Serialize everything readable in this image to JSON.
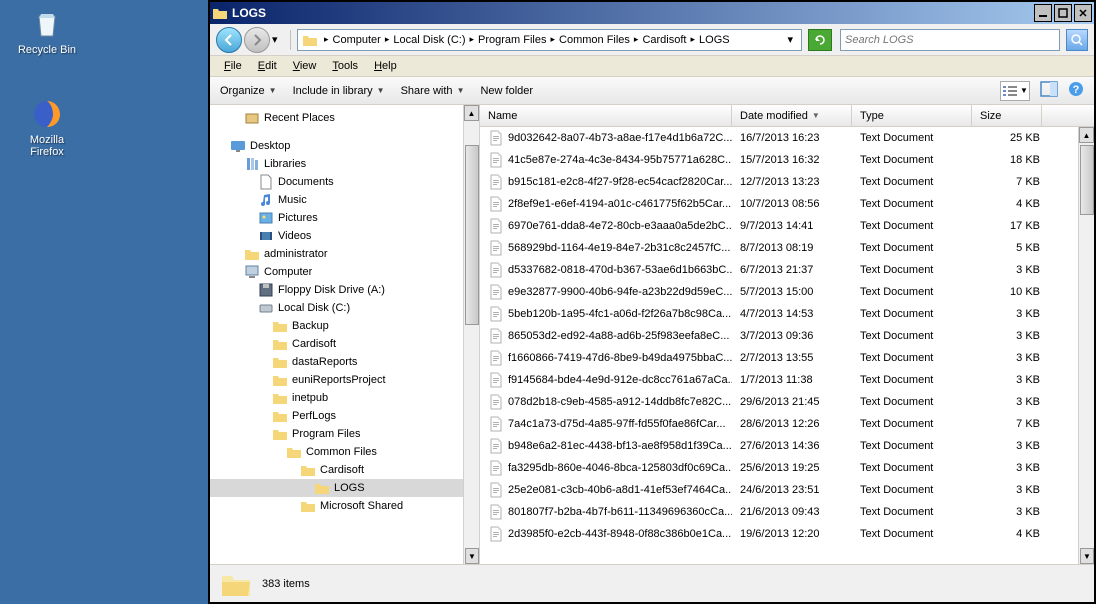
{
  "desktop": {
    "recycle_bin": "Recycle Bin",
    "firefox": "Mozilla Firefox"
  },
  "window": {
    "title": "LOGS"
  },
  "breadcrumb": {
    "items": [
      "Computer",
      "Local Disk (C:)",
      "Program Files",
      "Common Files",
      "Cardisoft",
      "LOGS"
    ]
  },
  "search": {
    "placeholder": "Search LOGS"
  },
  "menubar": {
    "file": "File",
    "edit": "Edit",
    "view": "View",
    "tools": "Tools",
    "help": "Help"
  },
  "toolbar": {
    "organize": "Organize",
    "include": "Include in library",
    "share": "Share with",
    "newfolder": "New folder"
  },
  "tree": {
    "recent_places": "Recent Places",
    "desktop": "Desktop",
    "libraries": "Libraries",
    "documents": "Documents",
    "music": "Music",
    "pictures": "Pictures",
    "videos": "Videos",
    "administrator": "administrator",
    "computer": "Computer",
    "floppy": "Floppy Disk Drive (A:)",
    "localdisk": "Local Disk (C:)",
    "backup": "Backup",
    "cardisoft": "Cardisoft",
    "dasta": "dastaReports",
    "euni": "euniReportsProject",
    "inetpub": "inetpub",
    "perflogs": "PerfLogs",
    "progfiles": "Program Files",
    "common": "Common Files",
    "cardisoft2": "Cardisoft",
    "logs": "LOGS",
    "msshared": "Microsoft Shared"
  },
  "columns": {
    "name": "Name",
    "date": "Date modified",
    "type": "Type",
    "size": "Size"
  },
  "files": [
    {
      "name": "9d032642-8a07-4b73-a8ae-f17e4d1b6a72C...",
      "date": "16/7/2013 16:23",
      "type": "Text Document",
      "size": "25 KB"
    },
    {
      "name": "41c5e87e-274a-4c3e-8434-95b75771a628C...",
      "date": "15/7/2013 16:32",
      "type": "Text Document",
      "size": "18 KB"
    },
    {
      "name": "b915c181-e2c8-4f27-9f28-ec54cacf2820Car...",
      "date": "12/7/2013 13:23",
      "type": "Text Document",
      "size": "7 KB"
    },
    {
      "name": "2f8ef9e1-e6ef-4194-a01c-c461775f62b5Car...",
      "date": "10/7/2013 08:56",
      "type": "Text Document",
      "size": "4 KB"
    },
    {
      "name": "6970e761-dda8-4e72-80cb-e3aaa0a5de2bC...",
      "date": "9/7/2013 14:41",
      "type": "Text Document",
      "size": "17 KB"
    },
    {
      "name": "568929bd-1164-4e19-84e7-2b31c8c2457fC...",
      "date": "8/7/2013 08:19",
      "type": "Text Document",
      "size": "5 KB"
    },
    {
      "name": "d5337682-0818-470d-b367-53ae6d1b663bC...",
      "date": "6/7/2013 21:37",
      "type": "Text Document",
      "size": "3 KB"
    },
    {
      "name": "e9e32877-9900-40b6-94fe-a23b22d9d59eC...",
      "date": "5/7/2013 15:00",
      "type": "Text Document",
      "size": "10 KB"
    },
    {
      "name": "5beb120b-1a95-4fc1-a06d-f2f26a7b8c98Ca...",
      "date": "4/7/2013 14:53",
      "type": "Text Document",
      "size": "3 KB"
    },
    {
      "name": "865053d2-ed92-4a88-ad6b-25f983eefa8eC...",
      "date": "3/7/2013 09:36",
      "type": "Text Document",
      "size": "3 KB"
    },
    {
      "name": "f1660866-7419-47d6-8be9-b49da4975bbaC...",
      "date": "2/7/2013 13:55",
      "type": "Text Document",
      "size": "3 KB"
    },
    {
      "name": "f9145684-bde4-4e9d-912e-dc8cc761a67aCa...",
      "date": "1/7/2013 11:38",
      "type": "Text Document",
      "size": "3 KB"
    },
    {
      "name": "078d2b18-c9eb-4585-a912-14ddb8fc7e82C...",
      "date": "29/6/2013 21:45",
      "type": "Text Document",
      "size": "3 KB"
    },
    {
      "name": "7a4c1a73-d75d-4a85-97ff-fd55f0fae86fCar...",
      "date": "28/6/2013 12:26",
      "type": "Text Document",
      "size": "7 KB"
    },
    {
      "name": "b948e6a2-81ec-4438-bf13-ae8f958d1f39Ca...",
      "date": "27/6/2013 14:36",
      "type": "Text Document",
      "size": "3 KB"
    },
    {
      "name": "fa3295db-860e-4046-8bca-125803df0c69Ca...",
      "date": "25/6/2013 19:25",
      "type": "Text Document",
      "size": "3 KB"
    },
    {
      "name": "25e2e081-c3cb-40b6-a8d1-41ef53ef7464Ca...",
      "date": "24/6/2013 23:51",
      "type": "Text Document",
      "size": "3 KB"
    },
    {
      "name": "801807f7-b2ba-4b7f-b611-11349696360cCa...",
      "date": "21/6/2013 09:43",
      "type": "Text Document",
      "size": "3 KB"
    },
    {
      "name": "2d3985f0-e2cb-443f-8948-0f88c386b0e1Ca...",
      "date": "19/6/2013 12:20",
      "type": "Text Document",
      "size": "4 KB"
    }
  ],
  "status": {
    "count": "383 items"
  }
}
